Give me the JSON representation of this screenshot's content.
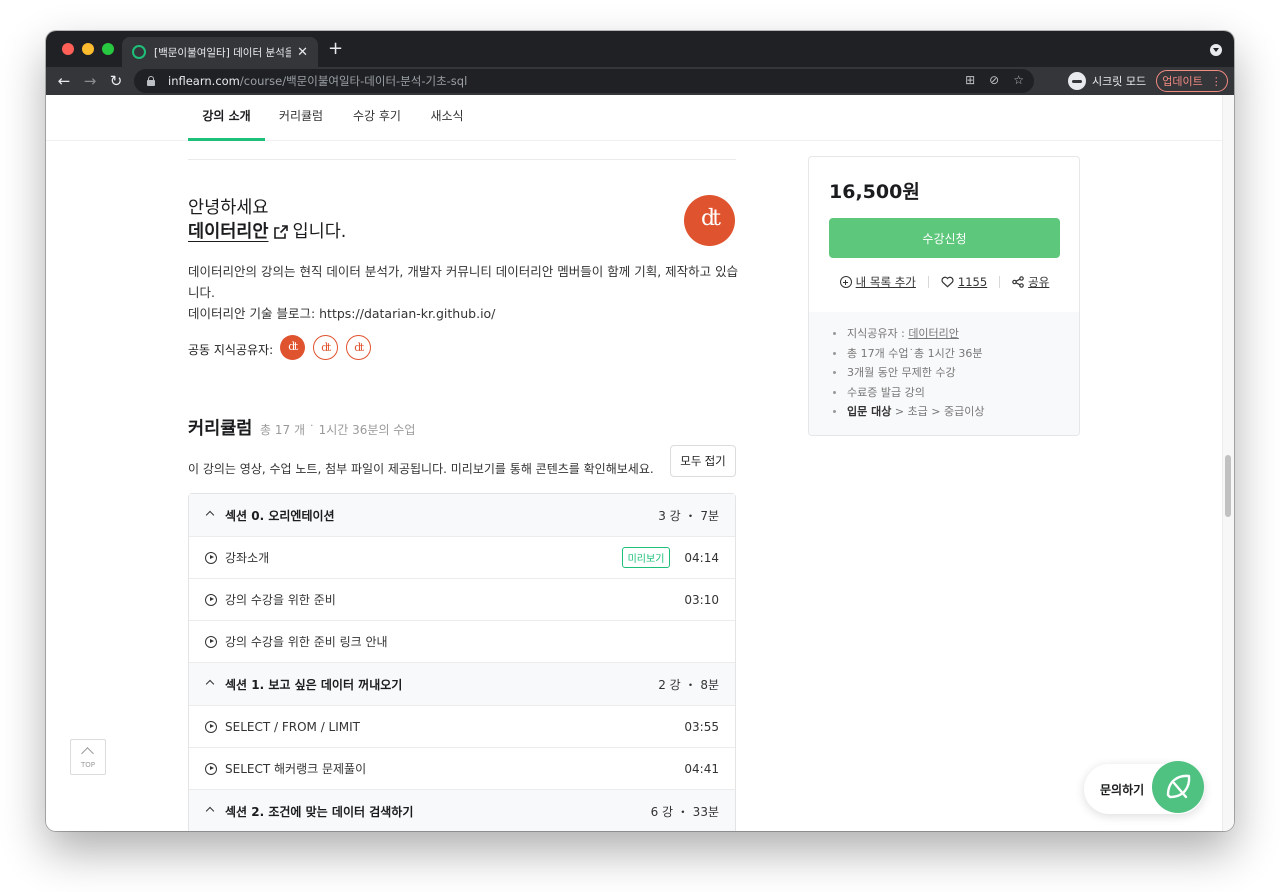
{
  "browser": {
    "tab_title": "[백문이불여일타] 데이터 분석을 위한",
    "new_tab_icon": "+",
    "url_host": "inflearn.com",
    "url_path": "/course/백문이불여일타-데이터-분석-기초-sql",
    "incognito_label": "시크릿 모드",
    "update_label": "업데이트"
  },
  "page_nav": {
    "tabs": [
      {
        "label": "강의 소개",
        "active": true
      },
      {
        "label": "커리큘럼",
        "active": false
      },
      {
        "label": "수강 후기",
        "active": false
      },
      {
        "label": "새소식",
        "active": false
      }
    ]
  },
  "intro": {
    "greeting": "안녕하세요",
    "instructor_name": "데이터리안",
    "instructor_suffix": "입니다.",
    "logo_text": "dt",
    "bio_line1": "데이터리안의 강의는 현직 데이터 분석가, 개발자 커뮤니티 데이터리안 멤버들이 함께 기획, 제작하고 있습니다.",
    "bio_line2": "데이터리안 기술 블로그: https://datarian-kr.github.io/",
    "co_sharers_label": "공동 지식공유자:"
  },
  "curriculum": {
    "title": "커리큘럼",
    "meta": "총 17 개 ˙ 1시간 36분의 수업",
    "description": "이 강의는 영상, 수업 노트, 첨부 파일이 제공됩니다. 미리보기를 통해 콘텐츠를 확인해보세요.",
    "collapse_label": "모두 접기",
    "sections": [
      {
        "title": "섹션 0. 오리엔테이션",
        "info": "3 강 ・ 7분",
        "lectures": [
          {
            "title": "강좌소개",
            "preview": "미리보기",
            "time": "04:14"
          },
          {
            "title": "강의 수강을 위한 준비",
            "preview": "",
            "time": "03:10"
          },
          {
            "title": "강의 수강을 위한 준비 링크 안내",
            "preview": "",
            "time": ""
          }
        ]
      },
      {
        "title": "섹션 1. 보고 싶은 데이터 꺼내오기",
        "info": "2 강 ・ 8분",
        "lectures": [
          {
            "title": "SELECT / FROM / LIMIT",
            "preview": "",
            "time": "03:55"
          },
          {
            "title": "SELECT 해커랭크 문제풀이",
            "preview": "",
            "time": "04:41"
          }
        ]
      },
      {
        "title": "섹션 2. 조건에 맞는 데이터 검색하기",
        "info": "6 강 ・ 33분",
        "lectures": []
      }
    ]
  },
  "sidebar": {
    "price": "16,500원",
    "enroll_label": "수강신청",
    "add_list_label": "내 목록 추가",
    "like_count": "1155",
    "share_label": "공유",
    "info": {
      "sharer_prefix": "지식공유자 :",
      "sharer_name": "데이터리안",
      "total": "총 17개 수업˙총 1시간 36분",
      "access": "3개월 동안 무제한 수강",
      "certificate": "수료증 발급 강의",
      "target_label": "입문 대상",
      "target_levels": "> 초급 > 중급이상"
    }
  },
  "floating": {
    "top_label": "TOP",
    "inquiry_label": "문의하기"
  },
  "colors": {
    "brand_green": "#1dc078",
    "enroll_green": "#5dc77c",
    "logo_orange": "#e0532f"
  }
}
